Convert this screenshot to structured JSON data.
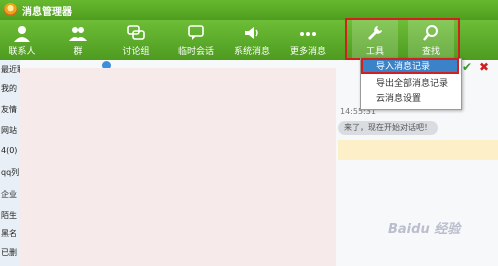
{
  "window": {
    "title": "消息管理器"
  },
  "toolbar": {
    "items": [
      {
        "label": "联系人",
        "icon": "contact-person-icon"
      },
      {
        "label": "群",
        "icon": "group-icon"
      },
      {
        "label": "讨论组",
        "icon": "discussion-group-icon"
      },
      {
        "label": "临时会话",
        "icon": "temp-chat-icon"
      },
      {
        "label": "系统消息",
        "icon": "speaker-icon"
      },
      {
        "label": "更多消息",
        "icon": "more-dots-icon"
      },
      {
        "label": "工具",
        "icon": "wrench-icon"
      },
      {
        "label": "查找",
        "icon": "search-icon"
      }
    ],
    "active_item": "工具"
  },
  "tools_menu": {
    "items": [
      "导入消息记录",
      "导出全部消息记录",
      "云消息设置"
    ],
    "selected": "导入消息记录"
  },
  "sidebar": {
    "items": [
      "最近联",
      "我的",
      "友情",
      "网站",
      "4(0)",
      "qq列",
      "企业",
      "陌生",
      "黑名",
      "已删"
    ]
  },
  "message_view": {
    "time": "14:55:31",
    "bubble": "来了，现在开始对话吧！"
  },
  "watermark": "Baidu 经验",
  "colors": {
    "toolbar_green": "#5aae27",
    "menu_highlight": "#3b83c9",
    "outline_red": "#d02020"
  }
}
